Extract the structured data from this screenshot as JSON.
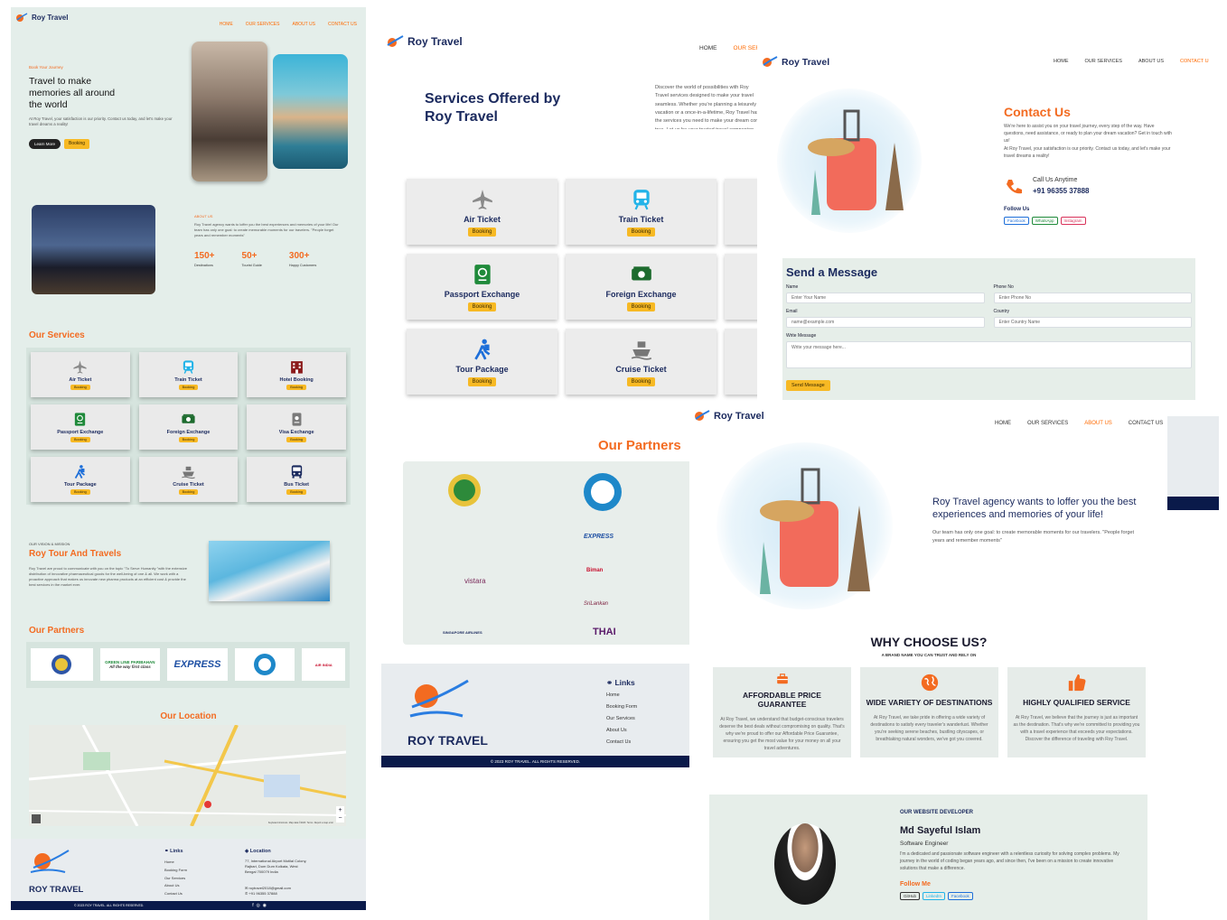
{
  "brand": "Roy Travel",
  "nav": {
    "home": "HOME",
    "services": "OUR SERVICES",
    "about": "ABOUT US",
    "contact": "CONTACT US"
  },
  "home": {
    "hero": {
      "kicker": "Book Your Journey",
      "title": "Travel to make memories all around the world",
      "text": "At Roy Travel, your satisfaction is our priority. Contact us today, and let's make your travel dreams a reality!",
      "learn_more": "Learn More",
      "booking": "Booking"
    },
    "about": {
      "kicker": "ABOUT US",
      "text": "Roy Travel agency wants to loffer you the best experiences and memories of your life! Our team has only one goal: to create memorable moments for our travelers. \"People forget years and remember moments\"",
      "stats": [
        {
          "value": "150+",
          "label": "Destinations"
        },
        {
          "value": "50+",
          "label": "Tourist Guide"
        },
        {
          "value": "300+",
          "label": "Happy Customers"
        }
      ]
    },
    "services_title": "Our Services",
    "services": [
      {
        "label": "Air Ticket",
        "icon": "plane-icon",
        "color": "#8a8a8a"
      },
      {
        "label": "Train Ticket",
        "icon": "train-icon",
        "color": "#22b3e8"
      },
      {
        "label": "Hotel Booking",
        "icon": "hotel-icon",
        "color": "#8b1a1a"
      },
      {
        "label": "Passport Exchange",
        "icon": "passport-icon",
        "color": "#1f8a3a"
      },
      {
        "label": "Foreign Exchange",
        "icon": "money-icon",
        "color": "#1d6b2e"
      },
      {
        "label": "Visa Exchange",
        "icon": "visa-icon",
        "color": "#7a7a7a"
      },
      {
        "label": "Tour Package",
        "icon": "hiker-icon",
        "color": "#1e6fd9"
      },
      {
        "label": "Cruise Ticket",
        "icon": "ship-icon",
        "color": "#777"
      },
      {
        "label": "Bus Ticket",
        "icon": "bus-icon",
        "color": "#1b2a5e"
      }
    ],
    "booking": "Booking",
    "vision": {
      "kicker": "OUR VISION & MISSION",
      "title": "Roy Tour And Travels",
      "text": "Roy Travel are proud to communicate with you on the topic \"To Serve Humanity \"with the extensive distribution of Innovative pharmaceutical goods for the well-being of one & all. We work with a proactive approach that makes us innovate new pharma products at an efficient cost & provide the best services in the market ever."
    },
    "partners_title": "Our Partners",
    "partners": [
      "GREEN LINE PARIBAHAN",
      "EXPRESS",
      "AIR INDIA"
    ],
    "partner_slogan": "All the way first class",
    "location_title": "Our Location",
    "map_labels": [
      "Keyboard shortcuts",
      "Map data ©2023",
      "Terms",
      "Report a map error"
    ],
    "footer": {
      "brand": "ROY TRAVEL",
      "links_title": "Links",
      "links": [
        "Home",
        "Booking Form",
        "Our Services",
        "About Us",
        "Contact Us"
      ],
      "location_title": "Location",
      "address": "77, International Airport Motilal Colony, Rajbari, Dum Dum Kolkata, West Bengal 700079 India",
      "email": "roytravel2018@gmail.com",
      "phone": "+91 96355 37888",
      "copyright": "© 2023 ROY TRAVEL. ALL RIGHTS RESERVED."
    }
  },
  "services_page": {
    "title": "Services Offered by Roy Travel",
    "intro": "Discover the world of possibilities with Roy Travel services designed to make your travel seamless. Whether you're planning a leisurely vacation or a once-in-a-lifetime, Roy Travel has the services you need to make your dream come true. Let us be your trusted travel companion.",
    "cards": [
      {
        "label": "Air Ticket",
        "icon": "plane-icon",
        "color": "#8a8a8a"
      },
      {
        "label": "Train Ticket",
        "icon": "train-icon",
        "color": "#22b3e8"
      },
      {
        "label": "Passport Exchange",
        "icon": "passport-icon",
        "color": "#1f8a3a"
      },
      {
        "label": "Foreign Exchange",
        "icon": "money-icon",
        "color": "#1d6b2e"
      },
      {
        "label": "Tour Package",
        "icon": "hiker-icon",
        "color": "#1e6fd9"
      },
      {
        "label": "Cruise Ticket",
        "icon": "ship-icon",
        "color": "#777"
      }
    ],
    "booking": "Booking",
    "partners_title": "Our Partners",
    "partners": [
      "EXPRESS",
      "vistara",
      "Biman",
      "SriLankan",
      "SINGAPORE AIRLINES",
      "THAI"
    ],
    "footer_brand": "ROY TRAVEL",
    "links_title": "Links",
    "links": [
      "Home",
      "Booking Form",
      "Our Services",
      "About Us",
      "Contact Us"
    ],
    "copyright": "© 2023 ROY TRAVEL. ALL RIGHTS RESERVED."
  },
  "contact_page": {
    "title": "Contact Us",
    "text1": "We're here to assist you on your travel journey, every step of the way. Have questions, need assistance, or ready to plan your dream vacation? Get in touch with us!",
    "text2": "At Roy Travel, your satisfaction is our priority. Contact us today, and let's make your travel dreams a reality!",
    "call_label": "Call Us Anytime",
    "phone": "+91 96355 37888",
    "follow": "Follow Us",
    "socials": [
      "Facebook",
      "WhatsApp",
      "Instagram"
    ],
    "form": {
      "title": "Send a Message",
      "name_label": "Name",
      "name_ph": "Enter Your Name",
      "phone_label": "Phone No",
      "phone_ph": "Enter Phone No",
      "email_label": "Email",
      "email_ph": "name@example.com",
      "country_label": "Country",
      "country_ph": "Enter Country Name",
      "message_label": "Write Message",
      "message_ph": "Write your message here...",
      "submit": "Send Message"
    }
  },
  "about_page": {
    "headline": "Roy Travel agency wants to loffer you the best experiences and memories of your life!",
    "sub": "Our team has only one goal: to create memorable moments for our travelers. \"People forget years and remember moments\"",
    "why_title": "WHY CHOOSE US?",
    "why_sub": "A BRAND NAME YOU CAN TRUST AND RELY ON",
    "why": [
      {
        "title": "AFFORDABLE PRICE GUARANTEE",
        "icon": "briefcase-icon",
        "text": "At Roy Travel, we understand that budget-conscious travelers deserve the best deals without compromising on quality. That's why we're proud to offer our Affordable Price Guarantee, ensuring you get the most value for your money on all your travel adventures."
      },
      {
        "title": "WIDE VARIETY OF DESTINATIONS",
        "icon": "globe-icon",
        "text": "At Roy Travel, we take pride in offering a wide variety of destinations to satisfy every traveler's wanderlust. Whether you're seeking serene beaches, bustling cityscapes, or breathtaking natural wonders, we've got you covered."
      },
      {
        "title": "HIGHLY QUALIFIED SERVICE",
        "icon": "thumbs-up-icon",
        "text": "At Roy Travel, we believe that the journey is just as important as the destination. That's why we're committed to providing you with a travel experience that exceeds your expectations. Discover the difference of traveling with Roy Travel."
      }
    ],
    "dev": {
      "kicker": "OUR WEBSITE DEVELOPER",
      "name": "Md Sayeful Islam",
      "role": "Software Engineer",
      "bio": "I'm a dedicated and passionate software engineer with a relentless curiosity for solving complex problems. My journey in the world of coding began years ago, and since then, I've been on a mission to create innovative solutions that make a difference.",
      "follow": "Follow Me",
      "links": [
        "GitHub",
        "LinkedIn",
        "Facebook"
      ]
    }
  }
}
